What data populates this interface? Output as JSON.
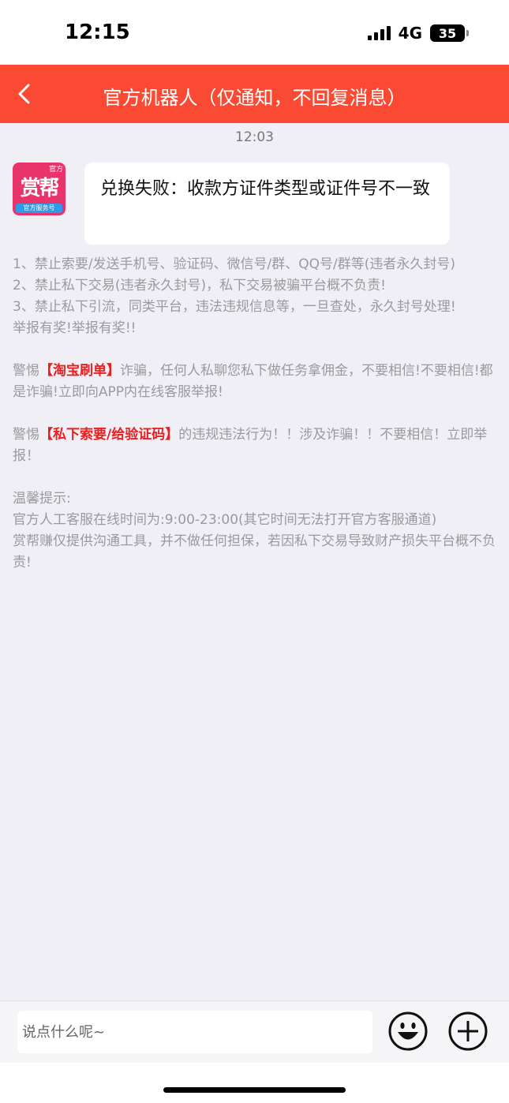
{
  "status_bar": {
    "time": "12:15",
    "network": "4G",
    "battery": "35"
  },
  "nav": {
    "title": "官方机器人（仅通知，不回复消息）"
  },
  "message": {
    "time": "12:03",
    "avatar": {
      "top_tag": "官方",
      "logo": "赏帮",
      "bottom_tag": "官方服务号"
    },
    "text": "兑换失败：收款方证件类型或证件号不一致"
  },
  "notice": {
    "rule1": "1、禁止索要/发送手机号、验证码、微信号/群、QQ号/群等(违者永久封号)",
    "rule2": "2、禁止私下交易(违者永久封号)，私下交易被骗平台概不负责!",
    "rule3": "3、禁止私下引流，同类平台，违法违规信息等，一旦查处，永久封号处理!",
    "report": "举报有奖!举报有奖!!",
    "warn1_prefix": "警惕",
    "warn1_highlight": "【淘宝刷单】",
    "warn1_rest": "诈骗，任何人私聊您私下做任务拿佣金，不要相信!不要相信!都是诈骗!立即向APP内在线客服举报!",
    "warn2_prefix": "警惕",
    "warn2_highlight": "【私下索要/给验证码】",
    "warn2_rest": "的违规违法行为！！涉及诈骗！！不要相信！立即举报！",
    "tip_title": "温馨提示:",
    "tip_hours": "官方人工客服在线时间为:9:00-23:00(其它时间无法打开官方客服通道)",
    "tip_disclaimer": "赏帮赚仅提供沟通工具，并不做任何担保，若因私下交易导致财产损失平台概不负责!"
  },
  "input": {
    "placeholder": "说点什么呢~"
  },
  "icons": {
    "back": "chevron-left-icon",
    "emoji": "smiley-icon",
    "plus": "plus-circle-icon"
  },
  "colors": {
    "nav_bg": "#fb4a33",
    "highlight": "#e8201f",
    "page_bg": "#f0eff5"
  }
}
